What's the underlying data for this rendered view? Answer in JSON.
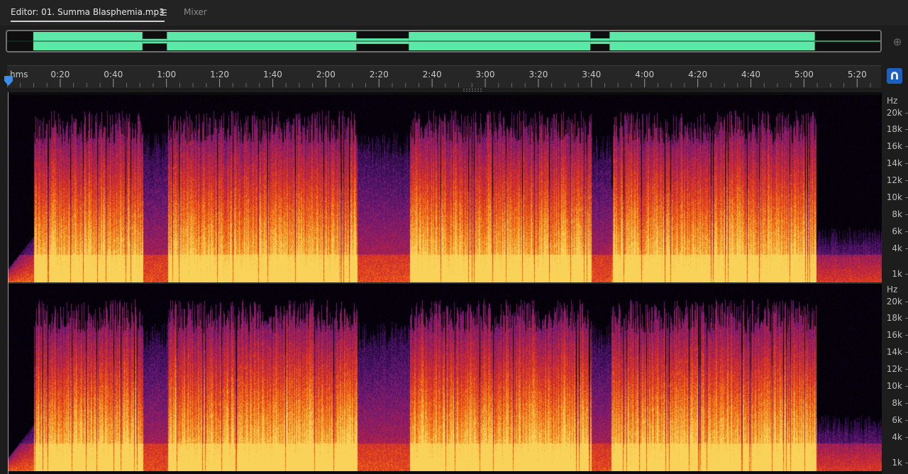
{
  "tabs": {
    "editor_label": "Editor: 01. Summa Blasphemia.mp3",
    "menu_icon": "☰",
    "mixer_label": "Mixer"
  },
  "overview": {
    "waveform_color": "#5ee8a8",
    "segments": [
      {
        "start": 0.03,
        "end": 0.155,
        "level": 1.0
      },
      {
        "start": 0.155,
        "end": 0.183,
        "level": 0.25
      },
      {
        "start": 0.183,
        "end": 0.4,
        "level": 1.0
      },
      {
        "start": 0.4,
        "end": 0.46,
        "level": 0.3
      },
      {
        "start": 0.46,
        "end": 0.668,
        "level": 1.0
      },
      {
        "start": 0.668,
        "end": 0.69,
        "level": 0.3
      },
      {
        "start": 0.69,
        "end": 0.925,
        "level": 1.0
      },
      {
        "start": 0.925,
        "end": 1.0,
        "level": 0.08
      }
    ],
    "zoom_icon": "zoom-to-selection-icon"
  },
  "ruler": {
    "unit_label": "hms",
    "ticks": [
      "0:20",
      "0:40",
      "1:00",
      "1:20",
      "1:40",
      "2:00",
      "2:20",
      "2:40",
      "3:00",
      "3:20",
      "3:40",
      "4:00",
      "4:20",
      "4:40",
      "5:00",
      "5:20"
    ],
    "tick_times_s": [
      20,
      40,
      60,
      80,
      100,
      120,
      140,
      160,
      180,
      200,
      220,
      240,
      260,
      280,
      300,
      320
    ],
    "visible_duration_s": 329,
    "snap_icon": "magnet-icon",
    "snap_color": "#1e5fbf"
  },
  "frequency_scale": {
    "unit_label": "Hz",
    "labels": [
      "20k",
      "18k",
      "16k",
      "14k",
      "12k",
      "10k",
      "8k",
      "6k",
      "4k",
      "1k"
    ],
    "values_hz": [
      20000,
      18000,
      16000,
      14000,
      12000,
      10000,
      8000,
      6000,
      4000,
      1000
    ],
    "max_hz": 22050
  },
  "spectrogram": {
    "palette": [
      "#000000",
      "#2a0a4a",
      "#6a1a7a",
      "#b0204a",
      "#e23a1a",
      "#f5881a",
      "#f9d25a"
    ],
    "loud_sections": [
      {
        "start": 0.03,
        "end": 0.155
      },
      {
        "start": 0.183,
        "end": 0.4
      },
      {
        "start": 0.46,
        "end": 0.668
      },
      {
        "start": 0.69,
        "end": 0.925
      }
    ]
  }
}
